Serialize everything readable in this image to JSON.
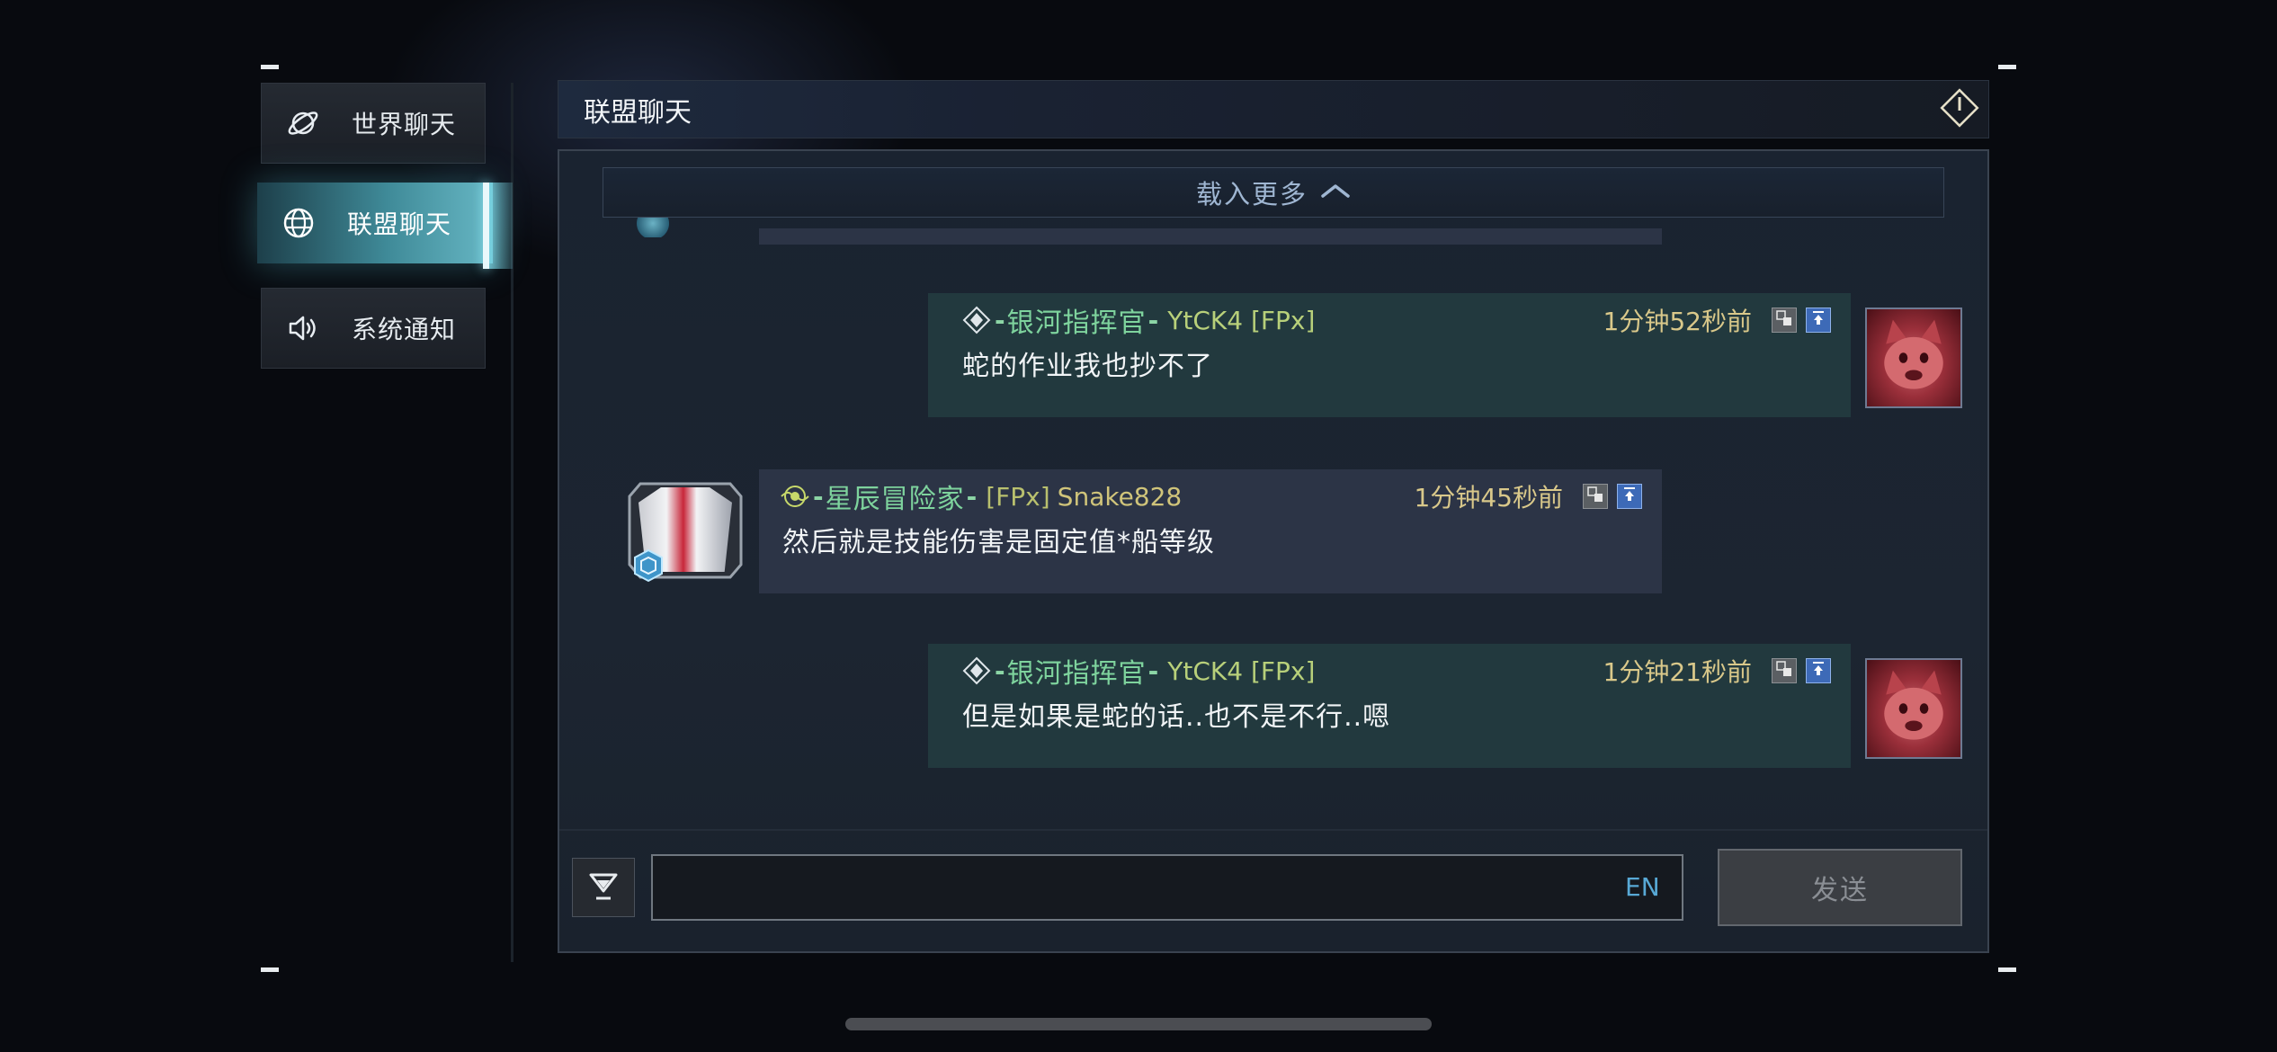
{
  "sidebar": {
    "tabs": [
      {
        "label": "世界聊天",
        "icon": "planet-icon"
      },
      {
        "label": "联盟聊天",
        "icon": "globe-icon"
      },
      {
        "label": "系统通知",
        "icon": "speaker-icon"
      }
    ],
    "active_index": 1
  },
  "panel": {
    "title": "联盟聊天",
    "exit_icon": "exit-icon",
    "load_more_label": "载入更多"
  },
  "messages": [
    {
      "side": "self",
      "title": "银河指挥官",
      "name": "YtCK4 [FPx]",
      "time": "1分钟52秒前",
      "text": "蛇的作业我也抄不了"
    },
    {
      "side": "other",
      "title": "星辰冒险家",
      "tag": "[FPx]",
      "name": "Snake828",
      "time": "1分钟45秒前",
      "text": "然后就是技能伤害是固定值*船等级"
    },
    {
      "side": "self",
      "title": "银河指挥官",
      "name": "YtCK4 [FPx]",
      "time": "1分钟21秒前",
      "text": "但是如果是蛇的话..也不是不行..嗯"
    }
  ],
  "input": {
    "value": "",
    "language": "EN",
    "send_label": "发送"
  },
  "colors": {
    "accent": "#67b7c4",
    "self_bubble": "#22393e",
    "other_bubble": "#2c3446",
    "title_green": "#7ed39d",
    "time_gold": "#d9c88a",
    "top_button_blue": "#3d6ab7"
  }
}
